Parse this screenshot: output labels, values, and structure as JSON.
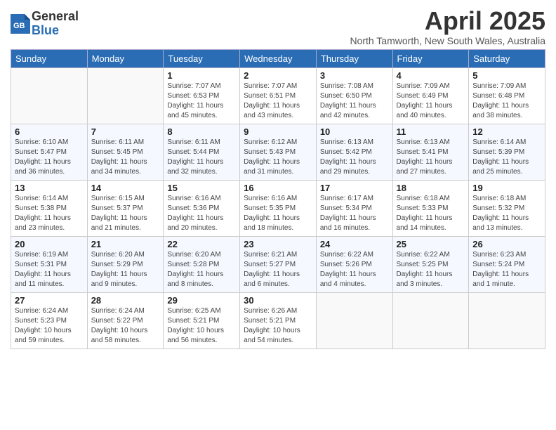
{
  "header": {
    "logo_general": "General",
    "logo_blue": "Blue",
    "month_title": "April 2025",
    "location": "North Tamworth, New South Wales, Australia"
  },
  "days_of_week": [
    "Sunday",
    "Monday",
    "Tuesday",
    "Wednesday",
    "Thursday",
    "Friday",
    "Saturday"
  ],
  "weeks": [
    [
      {
        "day": "",
        "details": ""
      },
      {
        "day": "",
        "details": ""
      },
      {
        "day": "1",
        "details": "Sunrise: 7:07 AM\nSunset: 6:53 PM\nDaylight: 11 hours and 45 minutes."
      },
      {
        "day": "2",
        "details": "Sunrise: 7:07 AM\nSunset: 6:51 PM\nDaylight: 11 hours and 43 minutes."
      },
      {
        "day": "3",
        "details": "Sunrise: 7:08 AM\nSunset: 6:50 PM\nDaylight: 11 hours and 42 minutes."
      },
      {
        "day": "4",
        "details": "Sunrise: 7:09 AM\nSunset: 6:49 PM\nDaylight: 11 hours and 40 minutes."
      },
      {
        "day": "5",
        "details": "Sunrise: 7:09 AM\nSunset: 6:48 PM\nDaylight: 11 hours and 38 minutes."
      }
    ],
    [
      {
        "day": "6",
        "details": "Sunrise: 6:10 AM\nSunset: 5:47 PM\nDaylight: 11 hours and 36 minutes."
      },
      {
        "day": "7",
        "details": "Sunrise: 6:11 AM\nSunset: 5:45 PM\nDaylight: 11 hours and 34 minutes."
      },
      {
        "day": "8",
        "details": "Sunrise: 6:11 AM\nSunset: 5:44 PM\nDaylight: 11 hours and 32 minutes."
      },
      {
        "day": "9",
        "details": "Sunrise: 6:12 AM\nSunset: 5:43 PM\nDaylight: 11 hours and 31 minutes."
      },
      {
        "day": "10",
        "details": "Sunrise: 6:13 AM\nSunset: 5:42 PM\nDaylight: 11 hours and 29 minutes."
      },
      {
        "day": "11",
        "details": "Sunrise: 6:13 AM\nSunset: 5:41 PM\nDaylight: 11 hours and 27 minutes."
      },
      {
        "day": "12",
        "details": "Sunrise: 6:14 AM\nSunset: 5:39 PM\nDaylight: 11 hours and 25 minutes."
      }
    ],
    [
      {
        "day": "13",
        "details": "Sunrise: 6:14 AM\nSunset: 5:38 PM\nDaylight: 11 hours and 23 minutes."
      },
      {
        "day": "14",
        "details": "Sunrise: 6:15 AM\nSunset: 5:37 PM\nDaylight: 11 hours and 21 minutes."
      },
      {
        "day": "15",
        "details": "Sunrise: 6:16 AM\nSunset: 5:36 PM\nDaylight: 11 hours and 20 minutes."
      },
      {
        "day": "16",
        "details": "Sunrise: 6:16 AM\nSunset: 5:35 PM\nDaylight: 11 hours and 18 minutes."
      },
      {
        "day": "17",
        "details": "Sunrise: 6:17 AM\nSunset: 5:34 PM\nDaylight: 11 hours and 16 minutes."
      },
      {
        "day": "18",
        "details": "Sunrise: 6:18 AM\nSunset: 5:33 PM\nDaylight: 11 hours and 14 minutes."
      },
      {
        "day": "19",
        "details": "Sunrise: 6:18 AM\nSunset: 5:32 PM\nDaylight: 11 hours and 13 minutes."
      }
    ],
    [
      {
        "day": "20",
        "details": "Sunrise: 6:19 AM\nSunset: 5:31 PM\nDaylight: 11 hours and 11 minutes."
      },
      {
        "day": "21",
        "details": "Sunrise: 6:20 AM\nSunset: 5:29 PM\nDaylight: 11 hours and 9 minutes."
      },
      {
        "day": "22",
        "details": "Sunrise: 6:20 AM\nSunset: 5:28 PM\nDaylight: 11 hours and 8 minutes."
      },
      {
        "day": "23",
        "details": "Sunrise: 6:21 AM\nSunset: 5:27 PM\nDaylight: 11 hours and 6 minutes."
      },
      {
        "day": "24",
        "details": "Sunrise: 6:22 AM\nSunset: 5:26 PM\nDaylight: 11 hours and 4 minutes."
      },
      {
        "day": "25",
        "details": "Sunrise: 6:22 AM\nSunset: 5:25 PM\nDaylight: 11 hours and 3 minutes."
      },
      {
        "day": "26",
        "details": "Sunrise: 6:23 AM\nSunset: 5:24 PM\nDaylight: 11 hours and 1 minute."
      }
    ],
    [
      {
        "day": "27",
        "details": "Sunrise: 6:24 AM\nSunset: 5:23 PM\nDaylight: 10 hours and 59 minutes."
      },
      {
        "day": "28",
        "details": "Sunrise: 6:24 AM\nSunset: 5:22 PM\nDaylight: 10 hours and 58 minutes."
      },
      {
        "day": "29",
        "details": "Sunrise: 6:25 AM\nSunset: 5:21 PM\nDaylight: 10 hours and 56 minutes."
      },
      {
        "day": "30",
        "details": "Sunrise: 6:26 AM\nSunset: 5:21 PM\nDaylight: 10 hours and 54 minutes."
      },
      {
        "day": "",
        "details": ""
      },
      {
        "day": "",
        "details": ""
      },
      {
        "day": "",
        "details": ""
      }
    ]
  ]
}
